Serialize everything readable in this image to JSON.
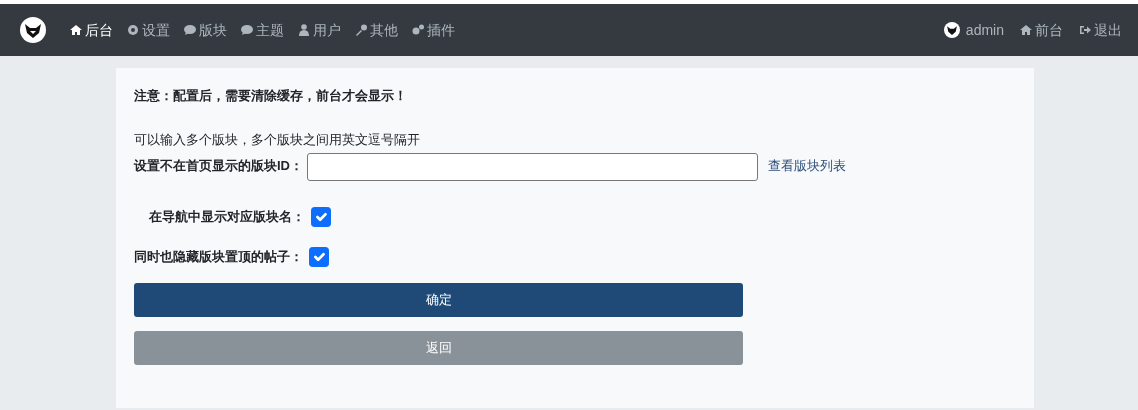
{
  "navbar": {
    "menu": [
      {
        "label": "后台",
        "selected": true
      },
      {
        "label": "设置",
        "selected": false
      },
      {
        "label": "版块",
        "selected": false
      },
      {
        "label": "主题",
        "selected": false
      },
      {
        "label": "用户",
        "selected": false
      },
      {
        "label": "其他",
        "selected": false
      },
      {
        "label": "插件",
        "selected": false
      }
    ],
    "right": [
      {
        "label": "admin"
      },
      {
        "label": "前台"
      },
      {
        "label": "退出"
      }
    ]
  },
  "form": {
    "notice": "注意：配置后，需要清除缓存，前台才会显示！",
    "hint": "可以输入多个版块，多个版块之间用英文逗号隔开",
    "forum_ids": {
      "label": "设置不在首页显示的版块ID：",
      "link": "查看版块列表"
    },
    "checkboxes": [
      {
        "label": "在导航中显示对应版块名：",
        "checked": true
      },
      {
        "label": "同时也隐藏版块置顶的帖子：",
        "checked": true
      }
    ],
    "buttons": [
      {
        "label": "确定",
        "kind": "primary"
      },
      {
        "label": "返回",
        "kind": "secondary"
      }
    ]
  }
}
